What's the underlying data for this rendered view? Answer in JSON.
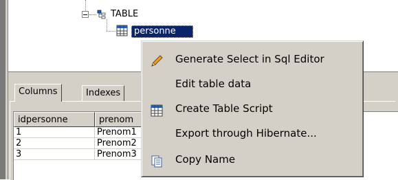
{
  "tree": {
    "node_table_label": "TABLE",
    "selected_node_label": "personne"
  },
  "tabs": [
    {
      "label": "Columns"
    },
    {
      "label": "Indexes"
    }
  ],
  "grid": {
    "columns": [
      "idpersonne",
      "prenom"
    ],
    "rows": [
      [
        "1",
        "Prenom1"
      ],
      [
        "2",
        "Prenom2"
      ],
      [
        "3",
        "Prenom3"
      ]
    ]
  },
  "context_menu": {
    "items": [
      {
        "label": "Generate Select in Sql Editor",
        "icon": "pencil-icon"
      },
      {
        "label": "Edit table data",
        "icon": ""
      },
      {
        "label": "Create Table Script",
        "icon": "table-icon"
      },
      {
        "label": "Export through Hibernate...",
        "icon": ""
      },
      {
        "label": "Copy Name",
        "icon": "copy-icon"
      }
    ]
  },
  "colors": {
    "window_face": "#d4d0c8",
    "selection": "#0a246a"
  }
}
